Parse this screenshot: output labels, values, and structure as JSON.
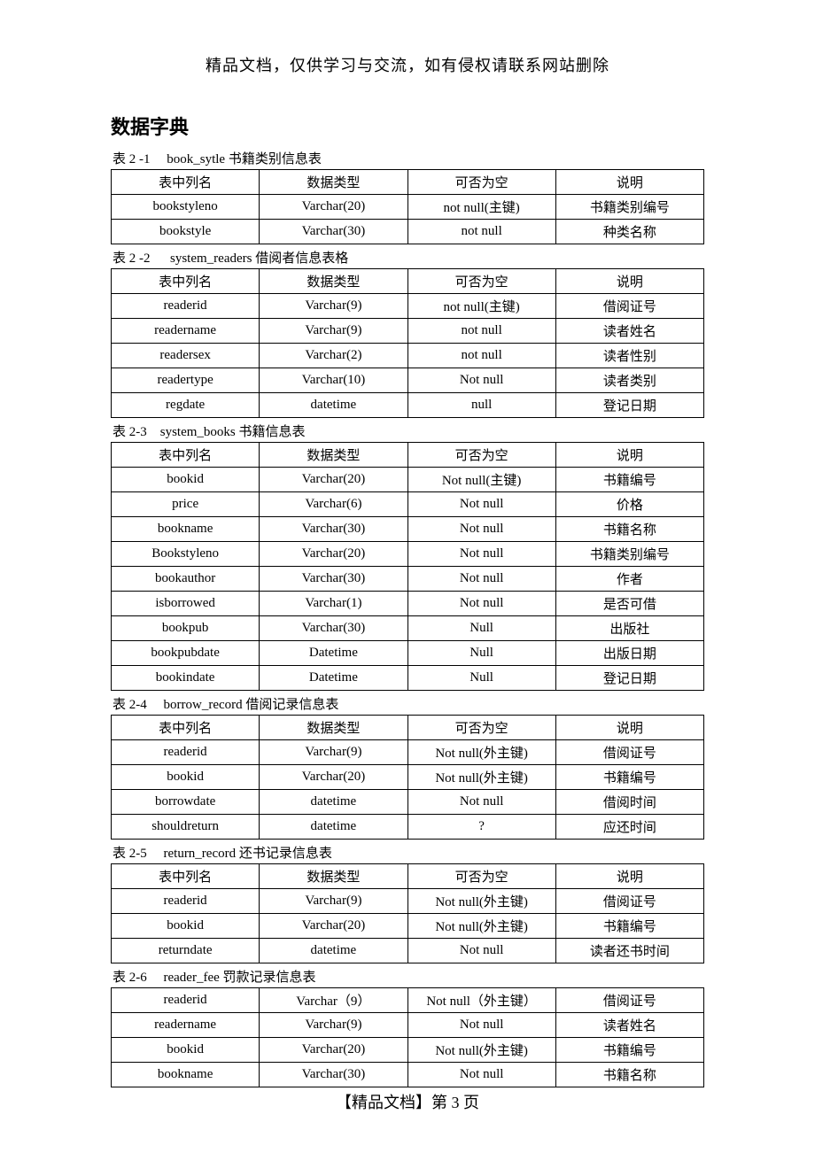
{
  "header_notice": "精品文档，仅供学习与交流，如有侵权请联系网站删除",
  "doc_title": "数据字典",
  "columns_header": [
    "表中列名",
    "数据类型",
    "可否为空",
    "说明"
  ],
  "tables": [
    {
      "caption": "表 2 -1 　book_sytle  书籍类别信息表",
      "show_header": true,
      "rows": [
        [
          "bookstyleno",
          "Varchar(20)",
          "not null(主键)",
          "书籍类别编号"
        ],
        [
          "bookstyle",
          "Varchar(30)",
          "not null",
          "种类名称"
        ]
      ]
    },
    {
      "caption": "表 2 -2 　 system_readers 借阅者信息表格",
      "show_header": true,
      "rows": [
        [
          "readerid",
          "Varchar(9)",
          "not null(主键)",
          "借阅证号"
        ],
        [
          "readername",
          "Varchar(9)",
          "not null",
          "读者姓名"
        ],
        [
          "readersex",
          "Varchar(2)",
          "not null",
          "读者性别"
        ],
        [
          "readertype",
          "Varchar(10)",
          "Not null",
          "读者类别"
        ],
        [
          "regdate",
          "datetime",
          "null",
          "登记日期"
        ]
      ]
    },
    {
      "caption": "表 2-3　system_books 书籍信息表",
      "show_header": true,
      "rows": [
        [
          "bookid",
          "Varchar(20)",
          "Not null(主键)",
          "书籍编号"
        ],
        [
          "price",
          "Varchar(6)",
          "Not null",
          "价格"
        ],
        [
          "bookname",
          "Varchar(30)",
          "Not null",
          "书籍名称"
        ],
        [
          "Bookstyleno",
          "Varchar(20)",
          "Not null",
          "书籍类别编号"
        ],
        [
          "bookauthor",
          "Varchar(30)",
          "Not null",
          "作者"
        ],
        [
          "isborrowed",
          "Varchar(1)",
          "Not null",
          "是否可借"
        ],
        [
          "bookpub",
          "Varchar(30)",
          "Null",
          "出版社"
        ],
        [
          "bookpubdate",
          "Datetime",
          "Null",
          "出版日期"
        ],
        [
          "bookindate",
          "Datetime",
          "Null",
          "登记日期"
        ]
      ]
    },
    {
      "caption": "表 2-4 　borrow_record  借阅记录信息表",
      "show_header": true,
      "rows": [
        [
          "readerid",
          "Varchar(9)",
          "Not null(外主键)",
          "借阅证号"
        ],
        [
          "bookid",
          "Varchar(20)",
          "Not null(外主键)",
          "书籍编号"
        ],
        [
          "borrowdate",
          "datetime",
          "Not null",
          "借阅时间"
        ],
        [
          "shouldreturn",
          "datetime",
          "?",
          "应还时间"
        ]
      ]
    },
    {
      "caption": "表 2-5 　return_record  还书记录信息表",
      "show_header": true,
      "rows": [
        [
          "readerid",
          "Varchar(9)",
          "Not null(外主键)",
          "借阅证号"
        ],
        [
          "bookid",
          "Varchar(20)",
          "Not null(外主键)",
          "书籍编号"
        ],
        [
          "returndate",
          "datetime",
          "Not null",
          "读者还书时间"
        ]
      ]
    },
    {
      "caption": "表 2-6 　reader_fee  罚款记录信息表",
      "show_header": false,
      "rows": [
        [
          "readerid",
          "Varchar（9）",
          "Not null（外主键）",
          "借阅证号"
        ],
        [
          "readername",
          "Varchar(9)",
          "Not null",
          "读者姓名"
        ],
        [
          "bookid",
          "Varchar(20)",
          "Not null(外主键)",
          "书籍编号"
        ],
        [
          "bookname",
          "Varchar(30)",
          "Not null",
          "书籍名称"
        ]
      ]
    }
  ],
  "footer": "【精品文档】第  3  页"
}
